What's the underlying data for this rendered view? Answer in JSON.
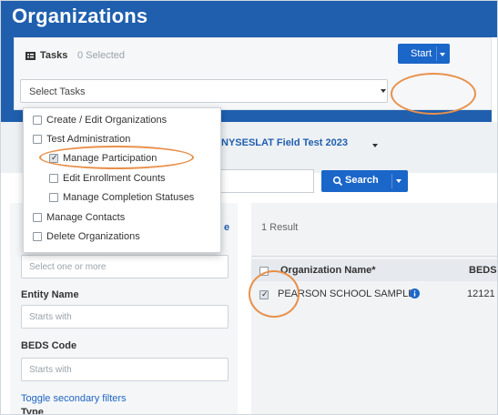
{
  "page": {
    "title": "Organizations"
  },
  "tasks": {
    "label": "Tasks",
    "selected_count": "0 Selected",
    "select_placeholder": "Select Tasks",
    "start_label": "Start"
  },
  "task_menu": {
    "items": [
      {
        "label": "Create / Edit Organizations",
        "checked": false
      },
      {
        "label": "Test Administration",
        "checked": false
      },
      {
        "label": "Manage Participation",
        "checked": true
      },
      {
        "label": "Edit Enrollment Counts",
        "checked": false
      },
      {
        "label": "Manage Completion Statuses",
        "checked": false
      },
      {
        "label": "Manage Contacts",
        "checked": false
      },
      {
        "label": "Delete Organizations",
        "checked": false
      }
    ]
  },
  "admin": {
    "selected": "NYSESLAT Field Test 2023"
  },
  "search": {
    "label": "Search"
  },
  "filters": {
    "first_placeholder": "Select one or more",
    "entity_name_label": "Entity Name",
    "entity_name_placeholder": "Starts with",
    "beds_code_label": "BEDS Code",
    "beds_code_placeholder": "Starts with",
    "toggle_link": "Toggle secondary filters",
    "type_label": "Type",
    "partial_link": "e"
  },
  "results": {
    "count": "1 Result",
    "columns": [
      "Organization Name*",
      "BEDS"
    ],
    "rows": [
      {
        "name": "PEARSON SCHOOL SAMPLE",
        "beds": "12121",
        "checked": true
      }
    ]
  },
  "colors": {
    "header_blue": "#1f5fae",
    "button_blue": "#1b66c9",
    "highlight_orange": "#e8904a"
  },
  "icons": [
    "tasks-icon",
    "search-icon",
    "info-icon",
    "chevron-down-icon"
  ]
}
